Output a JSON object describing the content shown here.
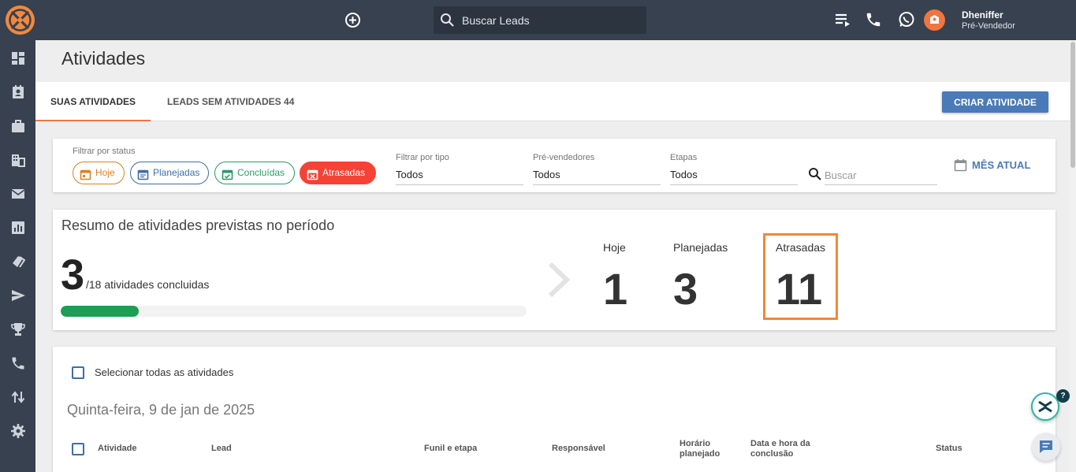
{
  "topbar": {
    "search_placeholder": "Buscar Leads",
    "user_name": "Dheniffer",
    "user_role": "Pré-Vendedor",
    "icons": [
      "add-circle-icon",
      "search-icon",
      "queue-list-icon",
      "phone-icon",
      "whatsapp-icon",
      "avatar"
    ]
  },
  "sidebar": {
    "items": [
      "dashboard-icon",
      "contacts-icon",
      "briefcase-icon",
      "building-icon",
      "mail-icon",
      "chart-icon",
      "tags-icon",
      "send-icon",
      "trophy-icon",
      "phone-icon",
      "swap-icon",
      "settings-icon"
    ]
  },
  "page": {
    "title": "Atividades"
  },
  "tabs": {
    "items": [
      {
        "label": "SUAS ATIVIDADES",
        "active": true
      },
      {
        "label": "LEADS SEM ATIVIDADES 44",
        "active": false
      }
    ],
    "create_button": "CRIAR ATIVIDADE"
  },
  "filters": {
    "status_label": "Filtrar por status",
    "chips": {
      "hoje": "Hoje",
      "planejadas": "Planejadas",
      "concluidas": "Concluídas",
      "atrasadas": "Atrasadas"
    },
    "tipo_label": "Filtrar por tipo",
    "tipo_value": "Todos",
    "pre_label": "Pré-vendedores",
    "pre_value": "Todos",
    "etapas_label": "Etapas",
    "etapas_value": "Todos",
    "search_placeholder": "Buscar",
    "period_button": "MÊS ATUAL"
  },
  "summary": {
    "title": "Resumo de atividades previstas no período",
    "completed": "3",
    "total_text": "/18 atividades concluidas",
    "progress_fraction": 0.1667,
    "stats": {
      "hoje_label": "Hoje",
      "hoje_value": "1",
      "planejadas_label": "Planejadas",
      "planejadas_value": "3",
      "atrasadas_label": "Atrasadas",
      "atrasadas_value": "11"
    }
  },
  "list": {
    "select_all": "Selecionar todas as atividades",
    "date_heading": "Quinta-feira, 9 de jan de 2025",
    "columns": {
      "atividade": "Atividade",
      "lead": "Lead",
      "funil": "Funil e etapa",
      "responsavel": "Responsável",
      "horario_1": "Horário",
      "horario_2": "planejado",
      "data_1": "Data e hora da",
      "data_2": "conclusão",
      "status": "Status"
    }
  },
  "colors": {
    "topbar": "#37414f",
    "accent_orange": "#f0753f",
    "primary_blue": "#4a7ab8",
    "success_green": "#1e9e55",
    "danger_red": "#f44336"
  }
}
